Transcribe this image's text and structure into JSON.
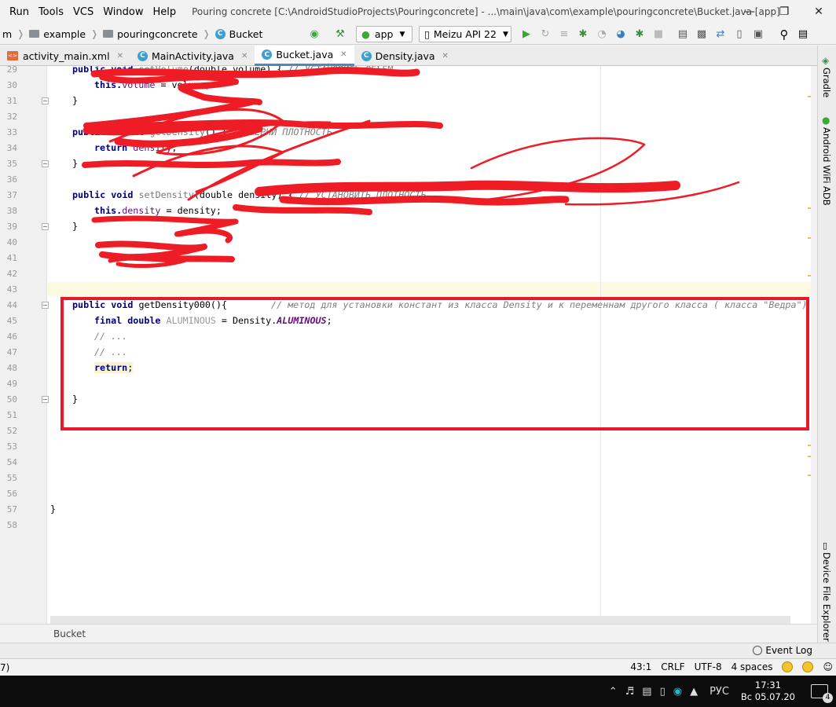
{
  "menu": {
    "items": [
      "Run",
      "Tools",
      "VCS",
      "Window",
      "Help"
    ],
    "title": "Pouring concrete [C:\\AndroidStudioProjects\\Pouringconcrete] - ...\\main\\java\\com\\example\\pouringconcrete\\Bucket.java [app]"
  },
  "nav": {
    "crumbs": [
      "m",
      "example",
      "pouringconcrete",
      "Bucket"
    ],
    "run_config": "app",
    "device": "Meizu API 22"
  },
  "tabs": [
    {
      "label": "activity_main.xml",
      "icon": "xml-file-icon"
    },
    {
      "label": "MainActivity.java",
      "icon": "class-icon"
    },
    {
      "label": "Bucket.java",
      "icon": "class-icon",
      "active": true
    },
    {
      "label": "Density.java",
      "icon": "class-icon"
    }
  ],
  "right_tools": [
    "Gradle",
    "Android WiFi ADB",
    "Device File Explorer"
  ],
  "editor": {
    "line_numbers": [
      "29",
      "30",
      "31",
      "32",
      "33",
      "34",
      "35",
      "36",
      "37",
      "38",
      "39",
      "40",
      "41",
      "42",
      "43",
      "44",
      "45",
      "46",
      "47",
      "48",
      "49",
      "50",
      "51",
      "52",
      "53",
      "54",
      "55",
      "56",
      "57",
      "58"
    ],
    "l29_kw": "public void",
    "l29_name": "setVolume",
    "l29_rest": "(double volume) { ",
    "l29_comment": "// УСТАНОВИТЬ ОБЪЁМ",
    "l30_this": "this.",
    "l30_field": "volume",
    "l30_rest": " = volume;",
    "l31": "}",
    "l33_kw": "public double",
    "l33_name": "getDensity",
    "l33_rest": "() { ",
    "l33_comment": "// ВЕРНИ ПЛОТНОСТЬ",
    "l34_kw": "return",
    "l34_field": "density",
    "l34_rest": ";",
    "l35": "}",
    "l37_kw": "public void",
    "l37_name": "setDensity",
    "l37_rest": "(double density) { ",
    "l37_comment": "// УСТАНОВИТЬ ПЛОТНОСТЬ",
    "l38_this": "this.",
    "l38_field": "density",
    "l38_rest": " = density;",
    "l39": "}",
    "l44_kw": "public void",
    "l44_rest": " getDensity000(){",
    "l44_comment": "// метод для установки констант из класса Density и к переменнам другого класса ( класса \"Ведра\")",
    "l45_kw": "final double",
    "l45_var": "ALUMINOUS",
    "l45_mid": " = Density.",
    "l45_const": "ALUMINOUS",
    "l45_end": ";",
    "l46": "// ...",
    "l47": "// ...",
    "l48_kw": "return",
    "l48_end": ";",
    "l50": "}",
    "l57": "}"
  },
  "editor_crumb": "Bucket",
  "bottom": {
    "event_log": "Event Log"
  },
  "status": {
    "left": "7)",
    "position": "43:1",
    "line_sep": "CRLF",
    "encoding": "UTF-8",
    "indent": "4 spaces"
  },
  "taskbar": {
    "lang": "РУС",
    "time": "17:31",
    "date": "Вс 05.07.20",
    "notifications": "4"
  },
  "colors": {
    "highlight_box": "#e8192c",
    "scribble": "#ee1c25",
    "active_tab_underline": "#4a88c7"
  }
}
